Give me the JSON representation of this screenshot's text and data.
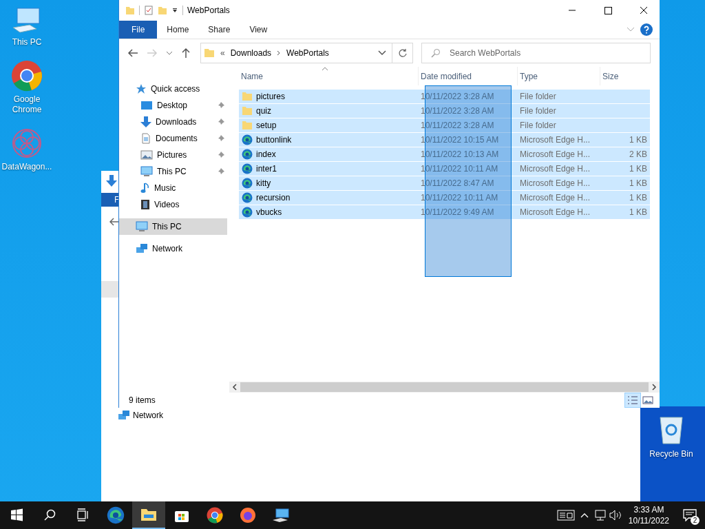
{
  "desktop_icons": [
    {
      "kind": "pc",
      "label": "This PC"
    },
    {
      "kind": "chrome",
      "label": "Google Chrome"
    },
    {
      "kind": "datawagon",
      "label": "DataWagon..."
    }
  ],
  "recycle_bin": {
    "label": "Recycle Bin"
  },
  "background_window": {
    "tab_letter": "F",
    "nav_item": "Network"
  },
  "window": {
    "title": "WebPortals",
    "ribbon_tabs": [
      {
        "label": "File",
        "selected": true
      },
      {
        "label": "Home",
        "selected": false
      },
      {
        "label": "Share",
        "selected": false
      },
      {
        "label": "View",
        "selected": false
      }
    ],
    "address": {
      "overflow": "«",
      "path": [
        "Downloads",
        "WebPortals"
      ]
    },
    "search": {
      "placeholder": "Search WebPortals"
    },
    "nav": [
      {
        "kind": "quick",
        "label": "Quick access",
        "selected": false,
        "children": [
          {
            "kind": "desktop",
            "label": "Desktop",
            "pinned": true,
            "selected": false
          },
          {
            "kind": "download",
            "label": "Downloads",
            "pinned": true,
            "selected": false
          },
          {
            "kind": "documents",
            "label": "Documents",
            "pinned": true,
            "selected": false
          },
          {
            "kind": "pictures",
            "label": "Pictures",
            "pinned": true,
            "selected": false
          },
          {
            "kind": "pc",
            "label": "This PC",
            "pinned": true,
            "selected": false
          },
          {
            "kind": "music",
            "label": "Music",
            "pinned": false,
            "selected": false
          },
          {
            "kind": "videos",
            "label": "Videos",
            "pinned": false,
            "selected": false
          }
        ]
      },
      {
        "kind": "pc",
        "label": "This PC",
        "selected": true
      },
      {
        "kind": "network",
        "label": "Network",
        "selected": false
      }
    ],
    "columns": [
      "Name",
      "Date modified",
      "Type",
      "Size"
    ],
    "rows": [
      {
        "kind": "folder",
        "name": "pictures",
        "date": "10/11/2022 3:28 AM",
        "type": "File folder",
        "selected": true
      },
      {
        "kind": "folder",
        "name": "quiz",
        "date": "10/11/2022 3:28 AM",
        "type": "File folder",
        "selected": true
      },
      {
        "kind": "folder",
        "name": "setup",
        "date": "10/11/2022 3:28 AM",
        "type": "File folder",
        "selected": true
      },
      {
        "kind": "edge",
        "name": "buttonlink",
        "date": "10/11/2022 10:15 AM",
        "type": "Microsoft Edge H...",
        "size": "1 KB",
        "selected": true
      },
      {
        "kind": "edge",
        "name": "index",
        "date": "10/11/2022 10:13 AM",
        "type": "Microsoft Edge H...",
        "size": "2 KB",
        "selected": true
      },
      {
        "kind": "edge",
        "name": "inter1",
        "date": "10/11/2022 10:11 AM",
        "type": "Microsoft Edge H...",
        "size": "1 KB",
        "selected": true
      },
      {
        "kind": "edge",
        "name": "kitty",
        "date": "10/11/2022 8:47 AM",
        "type": "Microsoft Edge H...",
        "size": "1 KB",
        "selected": true
      },
      {
        "kind": "edge",
        "name": "recursion",
        "date": "10/11/2022 10:11 AM",
        "type": "Microsoft Edge H...",
        "size": "1 KB",
        "selected": true
      },
      {
        "kind": "edge",
        "name": "vbucks",
        "date": "10/11/2022 9:49 AM",
        "type": "Microsoft Edge H...",
        "size": "1 KB",
        "selected": true
      }
    ],
    "status_bar": {
      "item_count": "9 items"
    }
  },
  "taskbar": {
    "apps": [
      {
        "kind": "edge",
        "active": false
      },
      {
        "kind": "explorer",
        "active": true
      },
      {
        "kind": "store",
        "active": false
      },
      {
        "kind": "chrome",
        "active": false
      },
      {
        "kind": "firefox",
        "active": false
      },
      {
        "kind": "remote",
        "active": false
      }
    ],
    "time": "3:33 AM",
    "date": "10/11/2022",
    "notification_count": "2"
  }
}
